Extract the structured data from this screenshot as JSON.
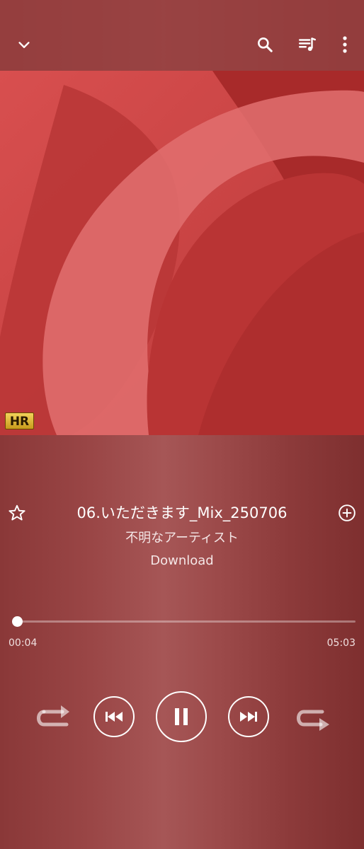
{
  "track": {
    "title": "06.いただきます_Mix_250706",
    "artist": "不明なアーティスト",
    "album": "Download",
    "badge": "HR"
  },
  "progress": {
    "elapsed": "00:04",
    "duration": "05:03",
    "fraction": 0.013
  },
  "icons": {
    "collapse": "chevron-down-icon",
    "search": "search-icon",
    "queue": "playlist-icon",
    "more": "more-vert-icon",
    "favorite": "star-outline-icon",
    "add": "add-circle-icon",
    "shuffle": "shuffle-icon",
    "previous": "skip-previous-icon",
    "pause": "pause-icon",
    "next": "skip-next-icon",
    "repeat": "repeat-icon"
  },
  "colors": {
    "background": "#9a4646",
    "artwork": "#c94646"
  }
}
